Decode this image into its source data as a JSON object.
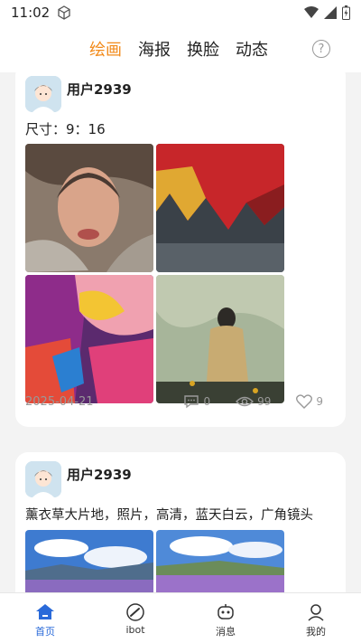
{
  "status": {
    "time": "11:02"
  },
  "tabs": [
    {
      "label": "绘画",
      "active": true
    },
    {
      "label": "海报",
      "active": false
    },
    {
      "label": "换脸",
      "active": false
    },
    {
      "label": "动态",
      "active": false
    }
  ],
  "help_label": "?",
  "posts": [
    {
      "user": "用户2939",
      "text": "尺寸：9：16",
      "date": "2025-04-21",
      "comments": "0",
      "views": "99",
      "likes": "9"
    },
    {
      "user": "用户2939",
      "text": "薰衣草大片地，照片，高清，蓝天白云，广角镜头"
    }
  ],
  "nav": [
    {
      "label": "首页",
      "active": true
    },
    {
      "label": "ibot",
      "active": false
    },
    {
      "label": "消息",
      "active": false
    },
    {
      "label": "我的",
      "active": false
    }
  ],
  "colors": {
    "accent": "#f28a1a",
    "nav_active": "#2a6ad9"
  }
}
